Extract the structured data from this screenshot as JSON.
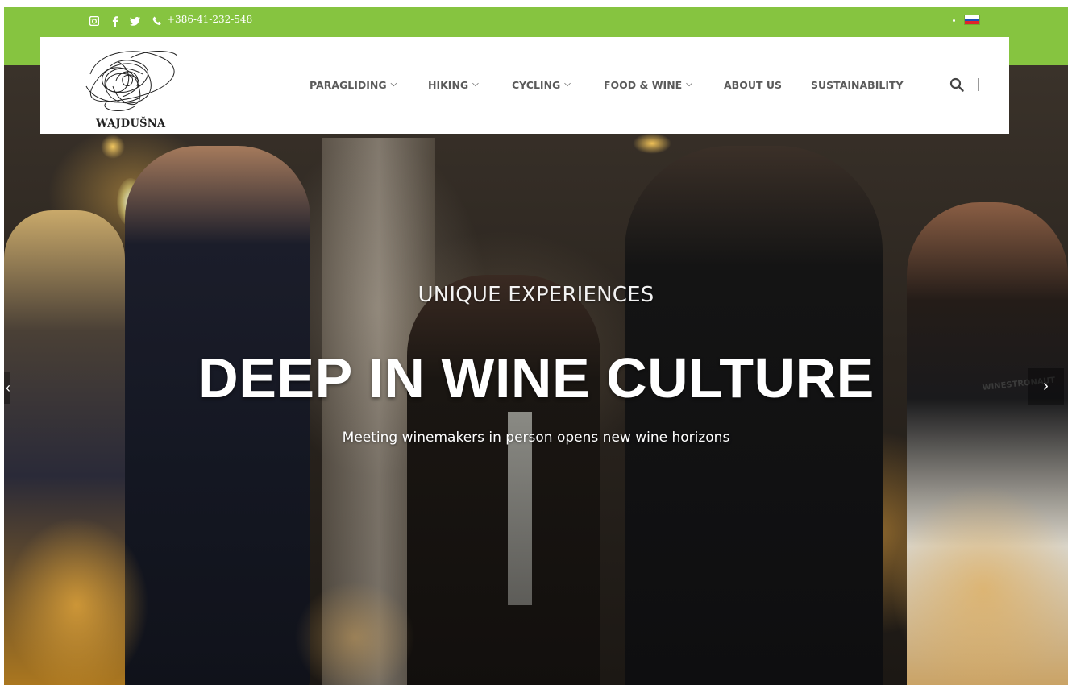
{
  "topbar": {
    "background": "#86c440",
    "social": [
      "instagram-icon",
      "facebook-icon",
      "twitter-icon",
      "phone-icon"
    ],
    "phone": "+386-41-232-548",
    "language_flag": "slovenia-flag-icon"
  },
  "header": {
    "logo_text": "WAJDUŠNA",
    "nav": [
      {
        "label": "PARAGLIDING",
        "has_dropdown": true
      },
      {
        "label": "HIKING",
        "has_dropdown": true
      },
      {
        "label": "CYCLING",
        "has_dropdown": true
      },
      {
        "label": "FOOD & WINE",
        "has_dropdown": true
      },
      {
        "label": "ABOUT US",
        "has_dropdown": false
      },
      {
        "label": "SUSTAINABILITY",
        "has_dropdown": false
      }
    ],
    "search_icon": "search-icon"
  },
  "hero": {
    "eyebrow": "UNIQUE EXPERIENCES",
    "headline": "DEEP IN WINE CULTURE",
    "subline": "Meeting winemakers in person opens new wine horizons",
    "prev_icon": "chevron-left-icon",
    "next_icon": "chevron-right-icon",
    "tshirt_text": "WINESTRONAUT"
  }
}
